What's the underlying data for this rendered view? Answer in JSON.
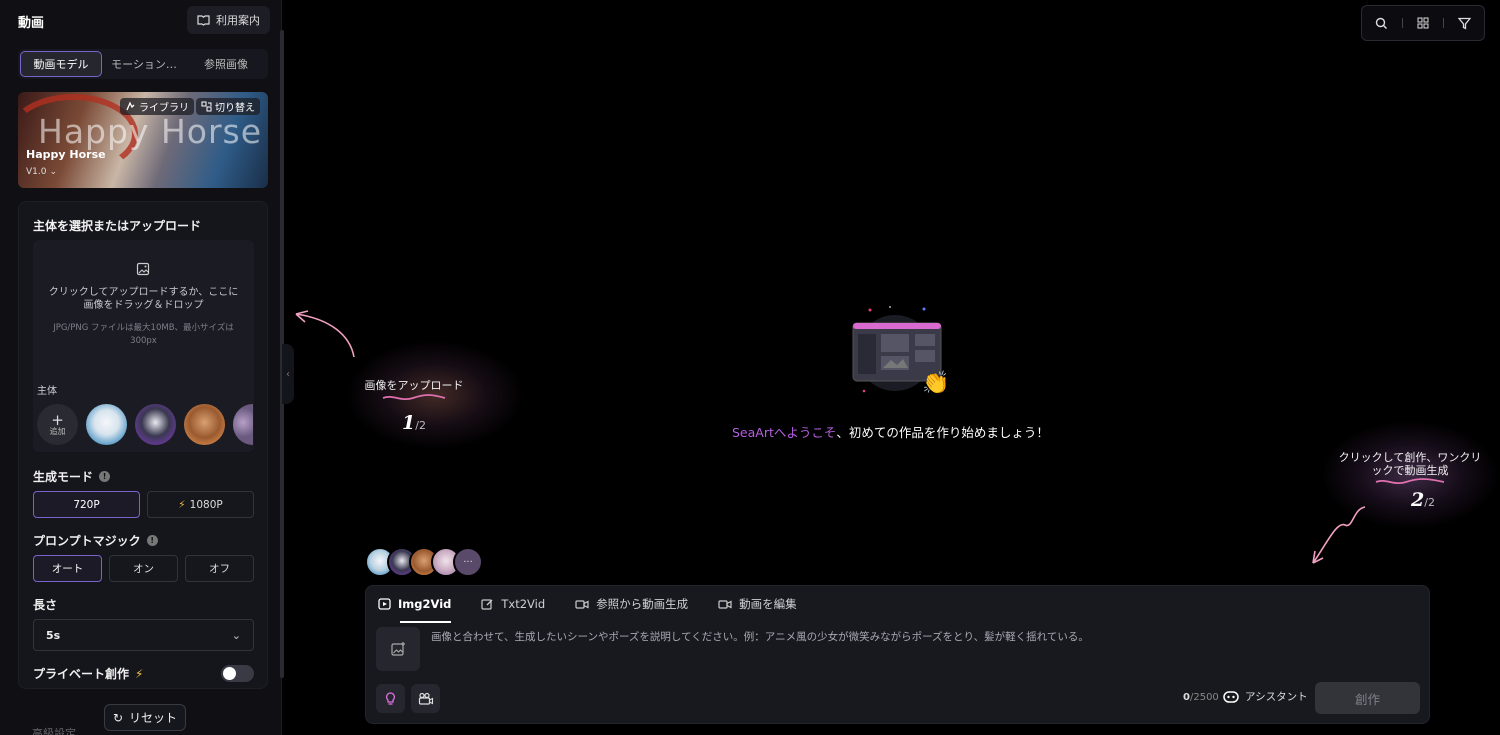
{
  "sidebar": {
    "title": "動画",
    "guide_label": "利用案内",
    "tabs": [
      "動画モデル",
      "モーション…",
      "参照画像"
    ],
    "model": {
      "big_title": "Happy Horse",
      "name": "Happy Horse",
      "version": "V1.0",
      "library_label": "ライブラリ",
      "switch_label": "切り替え"
    },
    "subject_section": {
      "title": "主体を選択またはアップロード",
      "upload_text": "クリックしてアップロードするか、ここに画像をドラッグ＆ドロップ",
      "upload_subtext": "JPG/PNG ファイルは最大10MB、最小サイズは300px",
      "subject_label": "主体",
      "add_label": "追加"
    },
    "generation_mode": {
      "label": "生成モード",
      "options": [
        "720P",
        "1080P"
      ],
      "selected": "720P"
    },
    "prompt_magic": {
      "label": "プロンプトマジック",
      "options": [
        "オート",
        "オン",
        "オフ"
      ],
      "selected": "オート"
    },
    "length": {
      "label": "長さ",
      "value": "5s"
    },
    "private": {
      "label": "プライベート創作",
      "enabled": false
    },
    "reset_label": "リセット",
    "advanced_label": "高級設定"
  },
  "toolbar": {
    "icons": [
      "search-icon",
      "grid-icon",
      "filter-icon"
    ]
  },
  "hero": {
    "brand": "SeaArt",
    "welcome": "へようこそ",
    "message": "、初めての作品を作り始めましょう！"
  },
  "guides": {
    "step1": {
      "text": "画像をアップロード",
      "num": "1",
      "den": "/2"
    },
    "step2": {
      "text": "クリックして創作、ワンクリックで動画生成",
      "num": "2",
      "den": "/2"
    }
  },
  "avatar_stack": {
    "more": "···"
  },
  "composer": {
    "tabs": [
      "Img2Vid",
      "Txt2Vid",
      "参照から動画生成",
      "動画を編集"
    ],
    "active_tab": "Img2Vid",
    "placeholder": "画像と合わせて、生成したいシーンやポーズを説明してください。例：アニメ風の少女が微笑みながらポーズをとり、髪が軽く揺れている。",
    "count_current": "0",
    "count_max": "/2500",
    "assistant_label": "アシスタント",
    "create_label": "創作"
  },
  "colors": {
    "accent": "#7a63c9",
    "brand": "#b55fe0"
  }
}
